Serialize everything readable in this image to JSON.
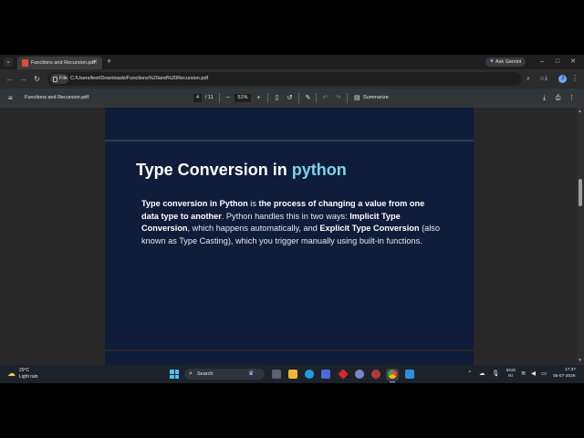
{
  "browser": {
    "tab": {
      "title": "Functions and Recursion.pdf",
      "close": "✕"
    },
    "new_tab": "+",
    "ask_gemini": "Ask Gemini",
    "window_controls": {
      "minimize": "–",
      "maximize": "□",
      "close": "✕"
    },
    "address": {
      "chip": "File",
      "url": "C:/Users/leet/Downloads/Functions%20and%20Recursion.pdf"
    },
    "profile_initial": "J"
  },
  "pdf_toolbar": {
    "title": "Functions and Recursion.pdf",
    "current_page": "4",
    "total_pages": "/ 11",
    "zoom": "51%",
    "summarize": "Summarize"
  },
  "slide": {
    "title_main": "Type Conversion in ",
    "title_accent": "python",
    "body": {
      "b1": "Type conversion in Python",
      "t1": " is ",
      "b2": "the process of changing a value from one data type to another",
      "t2": ". Python handles this in two ways: ",
      "b3": "Implicit Type Conversion",
      "t3": ", which happens automatically, and ",
      "b4": "Explicit Type Conversion",
      "t4": " (also known as Type Casting), which you trigger manually using built-in functions."
    }
  },
  "taskbar": {
    "weather": {
      "temp": "29°C",
      "desc": "Light rain"
    },
    "search_label": "Search",
    "language": {
      "line1": "ENG",
      "line2": "IN"
    },
    "clock": {
      "time": "17:37",
      "date": "05-07-2026"
    }
  },
  "colors": {
    "slide_background": "#0f1c3a",
    "title_accent": "#7ed3ea",
    "viewer_background": "#282828"
  }
}
